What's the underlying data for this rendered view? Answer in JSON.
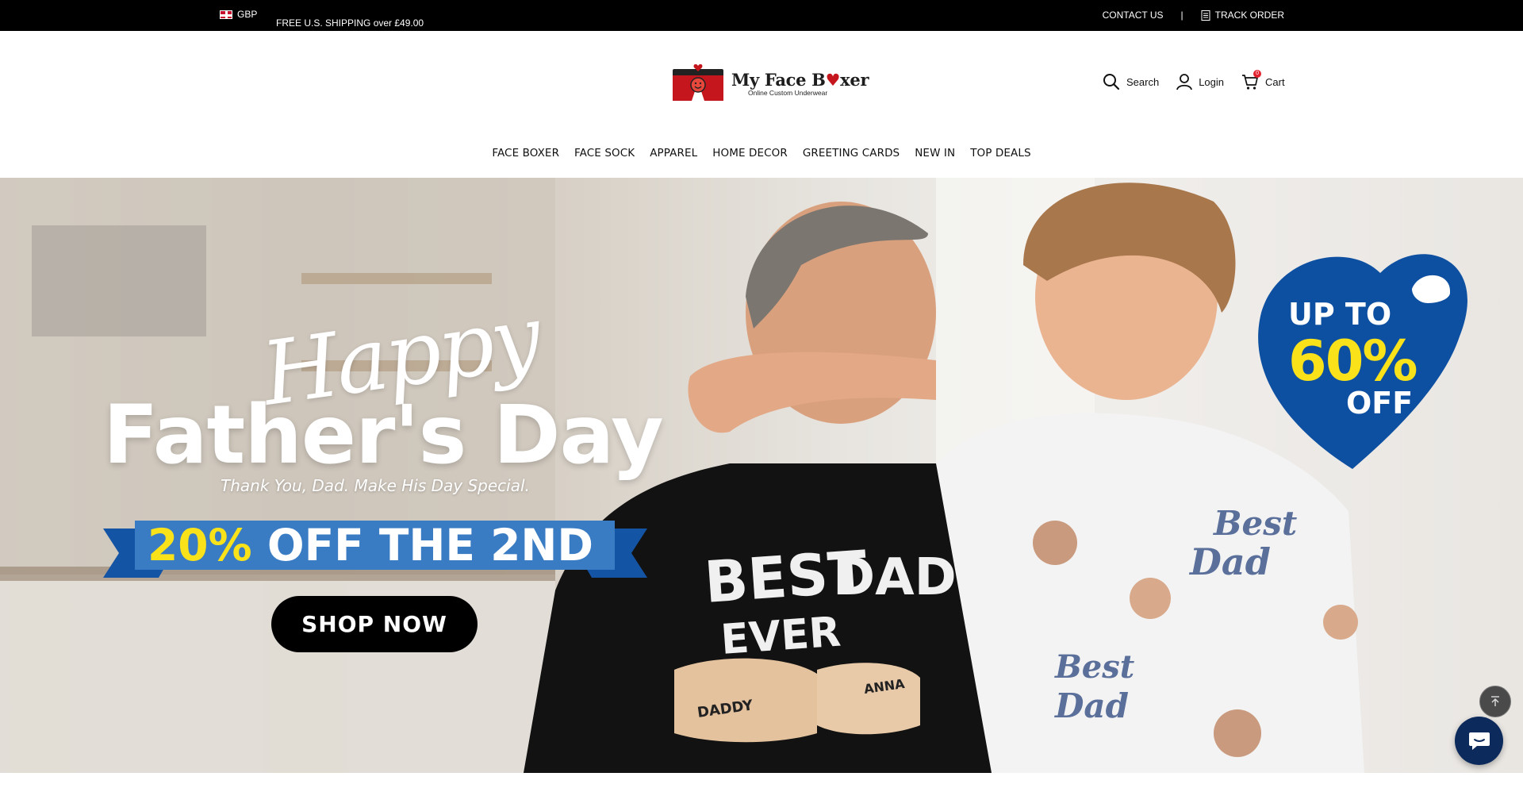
{
  "topbar": {
    "currency": "GBP",
    "shipping_text": "FREE U.S. SHIPPING over £49.00",
    "contact_label": "CONTACT US",
    "separator": "|",
    "track_label": "TRACK ORDER"
  },
  "header": {
    "logo_text_before": "My Face B",
    "logo_text_after": "xer",
    "logo_tagline": "Online Custom Underwear",
    "search_label": "Search",
    "login_label": "Login",
    "cart_label": "Cart",
    "cart_count": "0"
  },
  "nav": {
    "items": [
      {
        "label": "FACE BOXER"
      },
      {
        "label": "FACE SOCK"
      },
      {
        "label": "APPAREL"
      },
      {
        "label": "HOME DECOR"
      },
      {
        "label": "GREETING CARDS"
      },
      {
        "label": "NEW IN"
      },
      {
        "label": "TOP DEALS"
      }
    ]
  },
  "hero": {
    "script_title": "Happy",
    "title": "Father's Day",
    "subtitle": "Thank You, Dad. Make His Day Special.",
    "offer_highlight": "20%",
    "offer_text": "OFF THE 2ND",
    "cta_label": "SHOP NOW",
    "promo_line1": "UP TO",
    "promo_line2": "60%",
    "promo_line3": "OFF",
    "shirt_text_1": "BEST",
    "shirt_text_2": "DAD",
    "shirt_text_3": "EVER",
    "fist_label_left": "DADDY",
    "fist_label_right": "ANNA"
  },
  "colors": {
    "topbar_bg": "#000000",
    "accent_blue": "#0d4fa0",
    "accent_yellow": "#f9e21a",
    "brand_red": "#c4161c"
  },
  "icons": [
    "uk-flag-icon",
    "document-icon",
    "search-icon",
    "user-icon",
    "cart-icon",
    "arrow-up-icon",
    "chat-icon"
  ]
}
